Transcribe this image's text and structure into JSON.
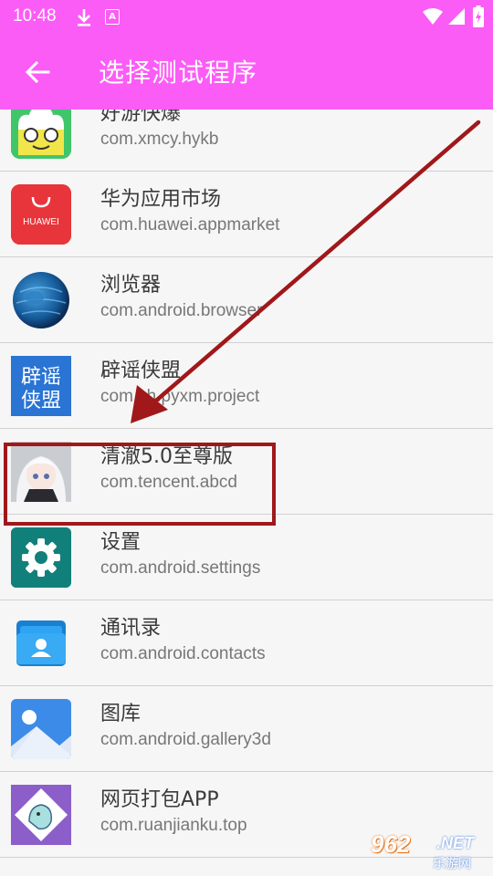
{
  "status": {
    "time": "10:48",
    "notif_letter": "A"
  },
  "appbar": {
    "title": "选择测试程序"
  },
  "apps": [
    {
      "name": "好游快爆",
      "package": "com.xmcy.hykb"
    },
    {
      "name": "华为应用市场",
      "package": "com.huawei.appmarket",
      "icon_text": "HUAWEI"
    },
    {
      "name": "浏览器",
      "package": "com.android.browser"
    },
    {
      "name": "辟谣侠盟",
      "package": "com.zh.pyxm.project",
      "icon_text": "辟谣侠盟"
    },
    {
      "name": "清澈5.0至尊版",
      "package": "com.tencent.abcd"
    },
    {
      "name": "设置",
      "package": "com.android.settings"
    },
    {
      "name": "通讯录",
      "package": "com.android.contacts"
    },
    {
      "name": "图库",
      "package": "com.android.gallery3d"
    },
    {
      "name": "网页打包APP",
      "package": "com.ruanjianku.top"
    }
  ],
  "watermark": {
    "number": "962",
    "suffix": ".NET",
    "cn": "乐游网"
  },
  "colors": {
    "accent": "#fb5cf6",
    "annotation": "#a0181a"
  }
}
